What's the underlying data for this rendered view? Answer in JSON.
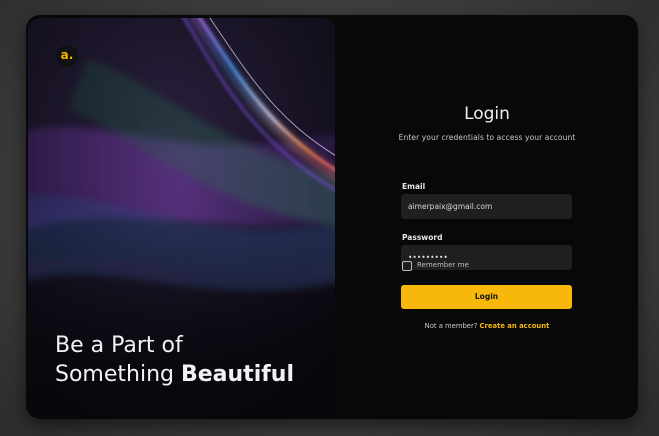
{
  "brand": {
    "logo_letter": "a.",
    "accent_color": "#f7b80b"
  },
  "hero": {
    "tagline_line1": "Be a Part of",
    "tagline_line2_regular": "Something ",
    "tagline_line2_bold": "Beautiful"
  },
  "form": {
    "title": "Login",
    "subtitle": "Enter your credentials to access your account",
    "email_label": "Email",
    "email_value": "aimerpaix@gmail.com",
    "password_label": "Password",
    "password_value": "•••••••••",
    "remember_label": "Remember me",
    "remember_checked": false,
    "login_button": "Login",
    "signup_prompt": "Not a member? ",
    "signup_link": "Create an account"
  }
}
